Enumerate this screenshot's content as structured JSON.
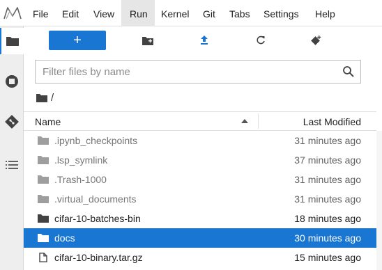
{
  "menu": {
    "items": [
      "File",
      "Edit",
      "View",
      "Run",
      "Kernel",
      "Git",
      "Tabs",
      "Settings",
      "Help"
    ],
    "active": "Run"
  },
  "toolbar": {
    "new_label": "+"
  },
  "filter": {
    "placeholder": "Filter files by name",
    "value": ""
  },
  "breadcrumb": {
    "path": "/"
  },
  "list": {
    "header_name": "Name",
    "header_modified": "Last Modified",
    "files": [
      {
        "name": ".ipynb_checkpoints",
        "modified": "31 minutes ago",
        "type": "folder",
        "hidden": true,
        "selected": false
      },
      {
        "name": ".lsp_symlink",
        "modified": "37 minutes ago",
        "type": "folder",
        "hidden": true,
        "selected": false
      },
      {
        "name": ".Trash-1000",
        "modified": "31 minutes ago",
        "type": "folder",
        "hidden": true,
        "selected": false
      },
      {
        "name": ".virtual_documents",
        "modified": "31 minutes ago",
        "type": "folder",
        "hidden": true,
        "selected": false
      },
      {
        "name": "cifar-10-batches-bin",
        "modified": "18 minutes ago",
        "type": "folder",
        "hidden": false,
        "selected": false
      },
      {
        "name": "docs",
        "modified": "30 minutes ago",
        "type": "folder",
        "hidden": false,
        "selected": true
      },
      {
        "name": "cifar-10-binary.tar.gz",
        "modified": "15 minutes ago",
        "type": "file",
        "hidden": false,
        "selected": false
      }
    ]
  },
  "colors": {
    "accent": "#1976d2",
    "folder_hidden": "#9e9e9e",
    "folder_normal": "#424242"
  },
  "icons": {
    "sidebar": [
      "folder-icon",
      "running-icon",
      "git-icon",
      "toc-icon"
    ],
    "toolbar": [
      "new-folder-icon",
      "upload-icon",
      "refresh-icon",
      "git-clone-icon"
    ]
  }
}
